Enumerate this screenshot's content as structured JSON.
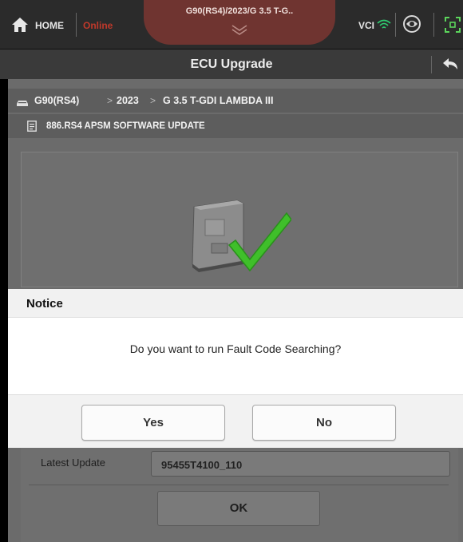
{
  "topbar": {
    "home_label": "HOME",
    "status": "Online",
    "vehicle_title": "G90(RS4)/2023/G 3.5 T-G..",
    "vci_label": "VCI"
  },
  "header": {
    "title": "ECU Upgrade"
  },
  "breadcrumb": [
    "G90(RS4)",
    ">",
    "2023",
    ">",
    "G 3.5 T-GDI LAMBDA III"
  ],
  "software_bar": {
    "label": "886.RS4 APSM SOFTWARE UPDATE"
  },
  "details": {
    "latest_update_label": "Latest Update",
    "latest_update_value": "95455T4100_110",
    "ok_label": "OK"
  },
  "modal": {
    "title": "Notice",
    "message": "Do you want to run Fault Code Searching?",
    "yes_label": "Yes",
    "no_label": "No"
  },
  "colors": {
    "status_online": "#c0392b",
    "title_tab": "#6f3430",
    "check_green": "#3fbf2a",
    "vci_signal": "#2ecc71",
    "scan_icon": "#5cd65c"
  },
  "icons": [
    "home-icon",
    "chevron-down-icon",
    "wifi-signal-icon",
    "vehicle-status-icon",
    "scan-icon",
    "back-icon",
    "car-icon",
    "document-icon",
    "ecu-module-icon",
    "checkmark-icon"
  ]
}
